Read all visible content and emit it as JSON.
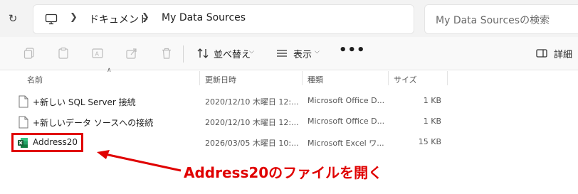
{
  "breadcrumb": {
    "items": [
      "ドキュメント",
      "My Data Sources"
    ]
  },
  "search": {
    "placeholder": "My Data Sourcesの検索"
  },
  "toolbar": {
    "sort_label": "並べ替え",
    "view_label": "表示",
    "details_label": "詳細"
  },
  "columns": {
    "name": "名前",
    "modified": "更新日時",
    "type": "種類",
    "size": "サイズ"
  },
  "files": [
    {
      "name": "+新しい SQL Server 接続",
      "modified": "2020/12/10 木曜日 12:...",
      "type": "Microsoft Office D...",
      "size": "1 KB",
      "icon": "odc-file-icon"
    },
    {
      "name": "+新しいデータ ソースへの接続",
      "modified": "2020/12/10 木曜日 12:...",
      "type": "Microsoft Office D...",
      "size": "1 KB",
      "icon": "odc-file-icon"
    },
    {
      "name": "Address20",
      "modified": "2026/03/05 木曜日 10:...",
      "type": "Microsoft Excel ワ...",
      "size": "15 KB",
      "icon": "excel-file-icon"
    }
  ],
  "annotation": {
    "text": "Address20のファイルを開く",
    "color": "#e00000"
  }
}
